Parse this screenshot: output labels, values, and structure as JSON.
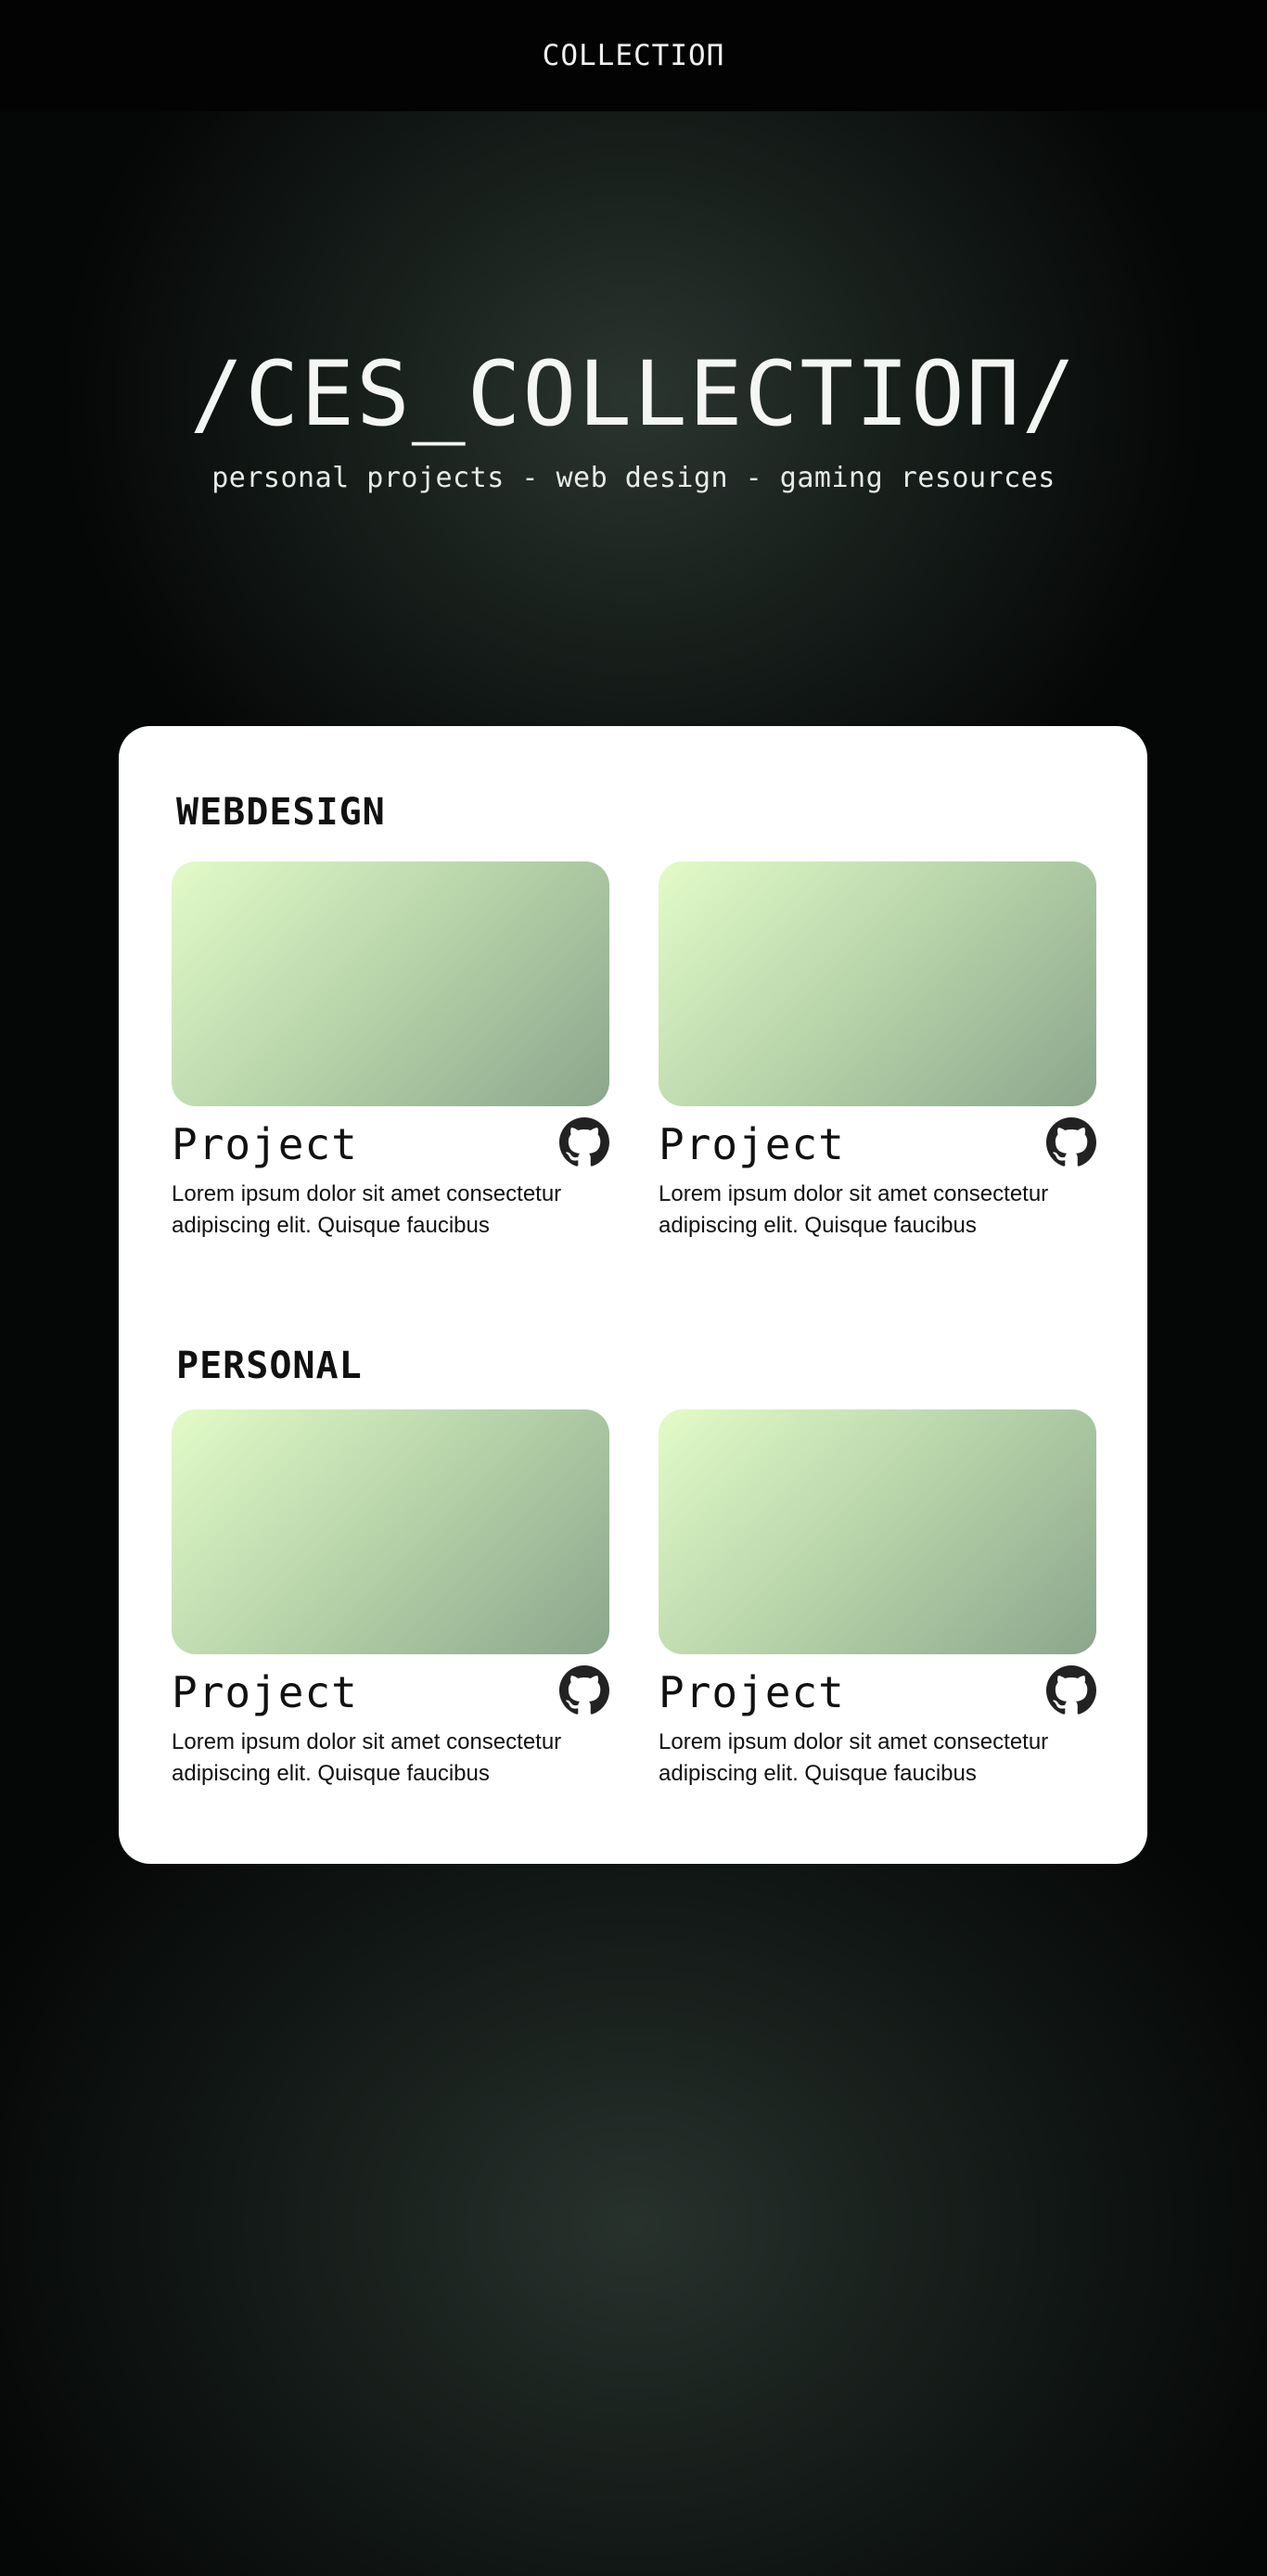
{
  "header": {
    "title": "COLLECTIOП"
  },
  "hero": {
    "title": "/CES_COLLECTIOП/",
    "subtitle": "personal projects - web design - gaming resources"
  },
  "sections": [
    {
      "title": "WEBDESIGN",
      "cards": [
        {
          "title": "Project",
          "description": "Lorem ipsum dolor sit amet consectetur adipiscing elit. Quisque faucibus",
          "icon": "github-icon"
        },
        {
          "title": "Project",
          "description": "Lorem ipsum dolor sit amet consectetur adipiscing elit. Quisque faucibus",
          "icon": "github-icon"
        }
      ]
    },
    {
      "title": "PERSONAL",
      "cards": [
        {
          "title": "Project",
          "description": "Lorem ipsum dolor sit amet consectetur adipiscing elit. Quisque faucibus",
          "icon": "github-icon"
        },
        {
          "title": "Project",
          "description": "Lorem ipsum dolor sit amet consectetur adipiscing elit. Quisque faucibus",
          "icon": "github-icon"
        }
      ]
    }
  ],
  "colors": {
    "background": "#050606",
    "panel": "#ffffff",
    "thumb_gradient_start": "#e3fbc8",
    "thumb_gradient_end": "#8ba68c",
    "icon": "#222222"
  }
}
